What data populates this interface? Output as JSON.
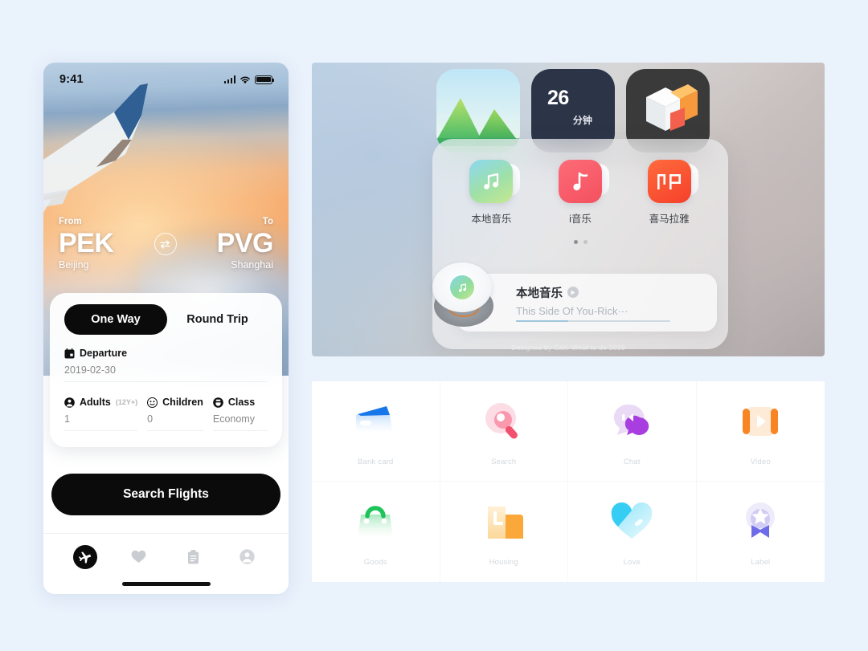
{
  "page": {
    "background": "#eaf2fc"
  },
  "phone": {
    "status": {
      "time": "9:41",
      "signal_icon": "signal-bars-icon",
      "wifi_icon": "wifi-icon",
      "battery_icon": "battery-icon"
    },
    "route": {
      "from_label": "From",
      "to_label": "To",
      "from_code": "PEK",
      "from_city": "Beijing",
      "to_code": "PVG",
      "to_city": "Shanghai",
      "swap_icon": "swap-arrows-icon"
    },
    "card": {
      "tabs": [
        {
          "label": "One  Way",
          "active": true
        },
        {
          "label": "Round Trip",
          "active": false
        }
      ],
      "departure": {
        "icon": "calendar-icon",
        "label": "Departure",
        "value": "2019-02-30"
      },
      "adults": {
        "icon": "person-icon",
        "label": "Adults",
        "sub": "(12Y+)",
        "value": "1"
      },
      "children": {
        "icon": "child-face-icon",
        "label": "Children",
        "value": "0"
      },
      "flight_class": {
        "icon": "seat-icon",
        "label": "Class",
        "value": "Economy"
      }
    },
    "cta": {
      "label": "Search Flights"
    },
    "tabbar": [
      {
        "name": "plane-icon",
        "active": true
      },
      {
        "name": "heart-icon",
        "active": false
      },
      {
        "name": "clipboard-icon",
        "active": false
      },
      {
        "name": "profile-icon",
        "active": false
      }
    ]
  },
  "widget_panel": {
    "top_widgets": [
      {
        "name": "photos-widget",
        "icon": "mountain-photo-icon"
      },
      {
        "name": "timer-widget",
        "value": "26",
        "unit": "分钟"
      },
      {
        "name": "cube-widget",
        "icon": "3d-cube-icon"
      }
    ],
    "apps": [
      {
        "label": "本地音乐",
        "icon": "music-note-icon",
        "accent": "#8bd8f0"
      },
      {
        "label": "i音乐",
        "icon": "music-quaver-icon",
        "accent": "#f4515f"
      },
      {
        "label": "喜马拉雅",
        "icon": "listen-icon",
        "accent": "#f5402a",
        "glyph": "听"
      }
    ],
    "page_dots": {
      "count": 2,
      "active_index": 0
    },
    "player": {
      "album_icon": "vinyl-disc-icon",
      "title": "本地音乐",
      "play_icon": "play-badge-icon",
      "track": "This Side Of You-Rick···",
      "progress_percent": 34
    },
    "footer_note": "Designed by Cait. What to do 2019"
  },
  "icon_grid": {
    "items": [
      {
        "label": "Bank card",
        "icon": "wallet-icon",
        "color": "#1877e8"
      },
      {
        "label": "Search",
        "icon": "magnifier-icon",
        "color": "#f8617f"
      },
      {
        "label": "Chat",
        "icon": "chat-bubbles-icon",
        "color": "#a93ee0"
      },
      {
        "label": "Video",
        "icon": "video-play-icon",
        "color": "#f98422"
      },
      {
        "label": "Goods",
        "icon": "shopping-bag-icon",
        "color": "#1ec35a"
      },
      {
        "label": "Housing",
        "icon": "buildings-icon",
        "color": "#f9a839"
      },
      {
        "label": "Love",
        "icon": "heart-icon",
        "color": "#36cdf4"
      },
      {
        "label": "Label",
        "icon": "star-badge-icon",
        "color": "#6e6ce8"
      }
    ]
  }
}
